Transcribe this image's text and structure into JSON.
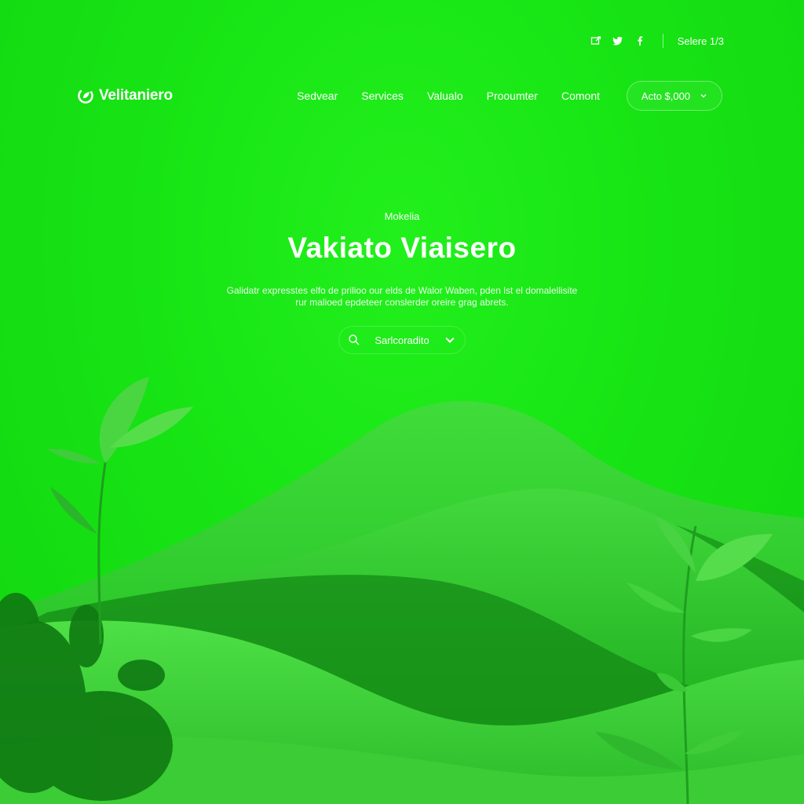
{
  "utility": {
    "icons": [
      "share-icon",
      "twitter-icon",
      "facebook-icon"
    ],
    "selector_label": "Selere 1/3"
  },
  "brand": {
    "name": "Velitaniero",
    "logo_icon": "leaf-logo-icon"
  },
  "nav": {
    "items": [
      {
        "label": "Sedvear"
      },
      {
        "label": "Services"
      },
      {
        "label": "Valualo"
      },
      {
        "label": "Prooumter"
      },
      {
        "label": "Comont"
      }
    ],
    "account_select": {
      "value": "Acto $,000"
    }
  },
  "hero": {
    "eyebrow": "Mokelia",
    "title": "Vakiato Viaisero",
    "description_line1": "Galidatr expresstes elfo de prilioo our elds de Walor Waben, pden lst el domalellisite",
    "description_line2": "rur malioed epdeteer conslerder oreire grag abrets.",
    "search": {
      "label": "Sarlcoradito"
    }
  },
  "colors": {
    "background": "#17e414",
    "hill_light": "#3ad83a",
    "hill_mid": "#22b822",
    "hill_dark": "#0f7d12",
    "text": "#ffffff"
  }
}
